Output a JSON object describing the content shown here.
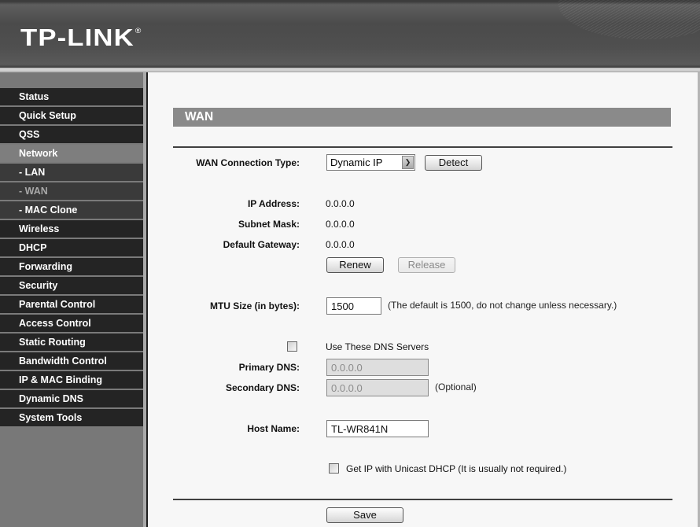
{
  "header": {
    "logo_text": "TP-LINK",
    "logo_mark": "®"
  },
  "sidebar": {
    "items": [
      {
        "label": "Status",
        "type": "top"
      },
      {
        "label": "Quick Setup",
        "type": "top"
      },
      {
        "label": "QSS",
        "type": "top"
      },
      {
        "label": "Network",
        "type": "active-group"
      },
      {
        "label": "- LAN",
        "type": "sub"
      },
      {
        "label": "- WAN",
        "type": "sub-current"
      },
      {
        "label": "- MAC Clone",
        "type": "sub"
      },
      {
        "label": "Wireless",
        "type": "top"
      },
      {
        "label": "DHCP",
        "type": "top"
      },
      {
        "label": "Forwarding",
        "type": "top"
      },
      {
        "label": "Security",
        "type": "top"
      },
      {
        "label": "Parental Control",
        "type": "top"
      },
      {
        "label": "Access Control",
        "type": "top"
      },
      {
        "label": "Static Routing",
        "type": "top"
      },
      {
        "label": "Bandwidth Control",
        "type": "top"
      },
      {
        "label": "IP & MAC Binding",
        "type": "top"
      },
      {
        "label": "Dynamic DNS",
        "type": "top"
      },
      {
        "label": "System Tools",
        "type": "top"
      }
    ]
  },
  "main": {
    "title": "WAN",
    "connection_type": {
      "label": "WAN Connection Type:",
      "selected": "Dynamic IP",
      "detect_label": "Detect"
    },
    "ip_address": {
      "label": "IP Address:",
      "value": "0.0.0.0"
    },
    "subnet_mask": {
      "label": "Subnet Mask:",
      "value": "0.0.0.0"
    },
    "default_gateway": {
      "label": "Default Gateway:",
      "value": "0.0.0.0"
    },
    "renew_label": "Renew",
    "release_label": "Release",
    "mtu": {
      "label": "MTU Size (in bytes):",
      "value": "1500",
      "hint": "(The default is 1500, do not change unless necessary.)"
    },
    "dns": {
      "use_label": "Use These DNS Servers",
      "use_checked": false,
      "primary_label": "Primary DNS:",
      "primary_value": "0.0.0.0",
      "secondary_label": "Secondary DNS:",
      "secondary_value": "0.0.0.0",
      "optional_hint": "(Optional)"
    },
    "host_name": {
      "label": "Host Name:",
      "value": "TL-WR841N"
    },
    "unicast": {
      "label": "Get IP with Unicast DHCP (It is usually not required.)",
      "checked": false
    },
    "save_label": "Save"
  }
}
